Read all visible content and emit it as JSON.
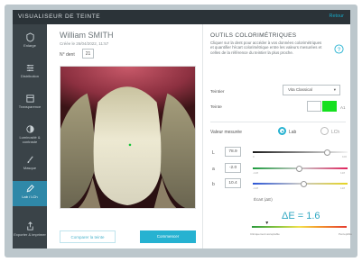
{
  "app": {
    "title": "VISUALISEUR DE TEINTE",
    "header_link": "Retour"
  },
  "sidebar": {
    "items": [
      {
        "label": "Enlarge",
        "icon": "shield-icon"
      },
      {
        "label": "Distribution",
        "icon": "sliders-icon"
      },
      {
        "label": "Transparence",
        "icon": "translucency-icon"
      },
      {
        "label": "Luminosité & contraste",
        "icon": "contrast-icon"
      },
      {
        "label": "Masque",
        "icon": "brush-icon"
      },
      {
        "label": "Lab / LCh",
        "icon": "eyedropper-icon"
      },
      {
        "label": "Exporter & imprimer",
        "icon": "share-icon"
      }
    ]
  },
  "patient": {
    "name": "William SMITH",
    "created": "Créée le 26/04/2022, 11:57",
    "tooth_label": "N° dent",
    "tooth_number": "21"
  },
  "buttons": {
    "compare": "Comparer la teinte",
    "confirm": "Commencer"
  },
  "tools": {
    "title": "OUTILS COLORIMÉTRIQUES",
    "help_text": "Cliquer sur la dent pour accéder à vos données colorimétriques et quantifier l'écart colorimétrique entre les valeurs mesurées et celles de la référence du teintier la plus proche.",
    "shade_label": "Teintier",
    "shade_value": "Vita Classical",
    "note_label": "Teinte",
    "note_unit": "A1",
    "note_swatch_color": "#15e01f"
  },
  "measure": {
    "label": "Valeur mesurée",
    "option_lab": "Lab",
    "option_lch": "LCh",
    "selected": "Lab"
  },
  "components": {
    "L": {
      "name": "L",
      "value": "78.9",
      "min": "0",
      "max": "100",
      "fraction": 0.789
    },
    "a": {
      "name": "a",
      "value": "-2.0",
      "min": "-128",
      "max": "128",
      "fraction": 0.492
    },
    "b": {
      "name": "b",
      "value": "10.4",
      "min": "-128",
      "max": "128",
      "fraction": 0.54
    }
  },
  "delta": {
    "title": "Écart (ΔE)",
    "value": "ΔE = 1.6",
    "fraction": 0.16,
    "scale_left": "Cliniquement acceptable",
    "scale_right": "Perceptible"
  }
}
